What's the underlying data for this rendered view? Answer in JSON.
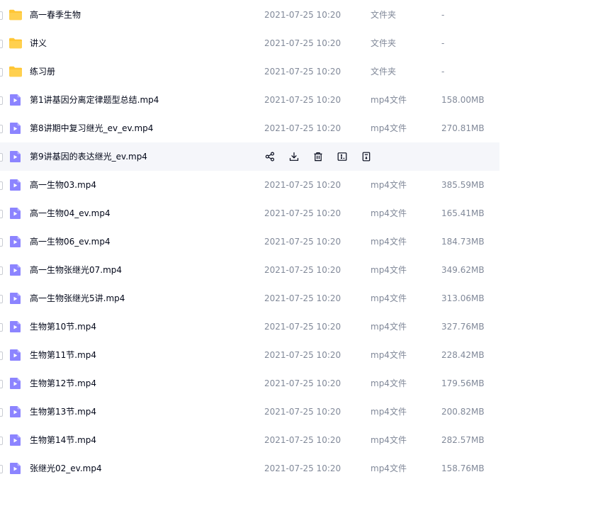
{
  "files": [
    {
      "name": "高一春季生物",
      "date": "2021-07-25 10:20",
      "type": "文件夹",
      "size": "-",
      "icon": "folder-icon"
    },
    {
      "name": "讲义",
      "date": "2021-07-25 10:20",
      "type": "文件夹",
      "size": "-",
      "icon": "folder-icon"
    },
    {
      "name": "练习册",
      "date": "2021-07-25 10:20",
      "type": "文件夹",
      "size": "-",
      "icon": "folder-icon"
    },
    {
      "name": "第1讲基因分离定律题型总结.mp4",
      "date": "2021-07-25 10:20",
      "type": "mp4文件",
      "size": "158.00MB",
      "icon": "video-file-icon"
    },
    {
      "name": "第8讲期中复习继光_ev_ev.mp4",
      "date": "2021-07-25 10:20",
      "type": "mp4文件",
      "size": "270.81MB",
      "icon": "video-file-icon"
    },
    {
      "name": "第9讲基因的表达继光_ev.mp4",
      "date": "",
      "type": "",
      "size": "",
      "icon": "video-file-icon",
      "hovered": true
    },
    {
      "name": "高一生物03.mp4",
      "date": "2021-07-25 10:20",
      "type": "mp4文件",
      "size": "385.59MB",
      "icon": "video-file-icon"
    },
    {
      "name": "高一生物04_ev.mp4",
      "date": "2021-07-25 10:20",
      "type": "mp4文件",
      "size": "165.41MB",
      "icon": "video-file-icon"
    },
    {
      "name": "高一生物06_ev.mp4",
      "date": "2021-07-25 10:20",
      "type": "mp4文件",
      "size": "184.73MB",
      "icon": "video-file-icon"
    },
    {
      "name": "高一生物张继光07.mp4",
      "date": "2021-07-25 10:20",
      "type": "mp4文件",
      "size": "349.62MB",
      "icon": "video-file-icon"
    },
    {
      "name": "高一生物张继光5讲.mp4",
      "date": "2021-07-25 10:20",
      "type": "mp4文件",
      "size": "313.06MB",
      "icon": "video-file-icon"
    },
    {
      "name": "生物第10节.mp4",
      "date": "2021-07-25 10:20",
      "type": "mp4文件",
      "size": "327.76MB",
      "icon": "video-file-icon"
    },
    {
      "name": "生物第11节.mp4",
      "date": "2021-07-25 10:20",
      "type": "mp4文件",
      "size": "228.42MB",
      "icon": "video-file-icon"
    },
    {
      "name": "生物第12节.mp4",
      "date": "2021-07-25 10:20",
      "type": "mp4文件",
      "size": "179.56MB",
      "icon": "video-file-icon"
    },
    {
      "name": "生物第13节.mp4",
      "date": "2021-07-25 10:20",
      "type": "mp4文件",
      "size": "200.82MB",
      "icon": "video-file-icon"
    },
    {
      "name": "生物第14节.mp4",
      "date": "2021-07-25 10:20",
      "type": "mp4文件",
      "size": "282.57MB",
      "icon": "video-file-icon"
    },
    {
      "name": "张继光02_ev.mp4",
      "date": "2021-07-25 10:20",
      "type": "mp4文件",
      "size": "158.76MB",
      "icon": "video-file-icon"
    }
  ],
  "hover_actions": [
    {
      "icon": "share-icon"
    },
    {
      "icon": "download-icon"
    },
    {
      "icon": "delete-icon"
    },
    {
      "icon": "rename-icon"
    },
    {
      "icon": "more-icon"
    }
  ],
  "colors": {
    "folder": "#ffc634",
    "video": "#8c84ff",
    "text_primary": "#03081a",
    "text_secondary": "#818999",
    "hover_bg": "#f5f6fa"
  }
}
